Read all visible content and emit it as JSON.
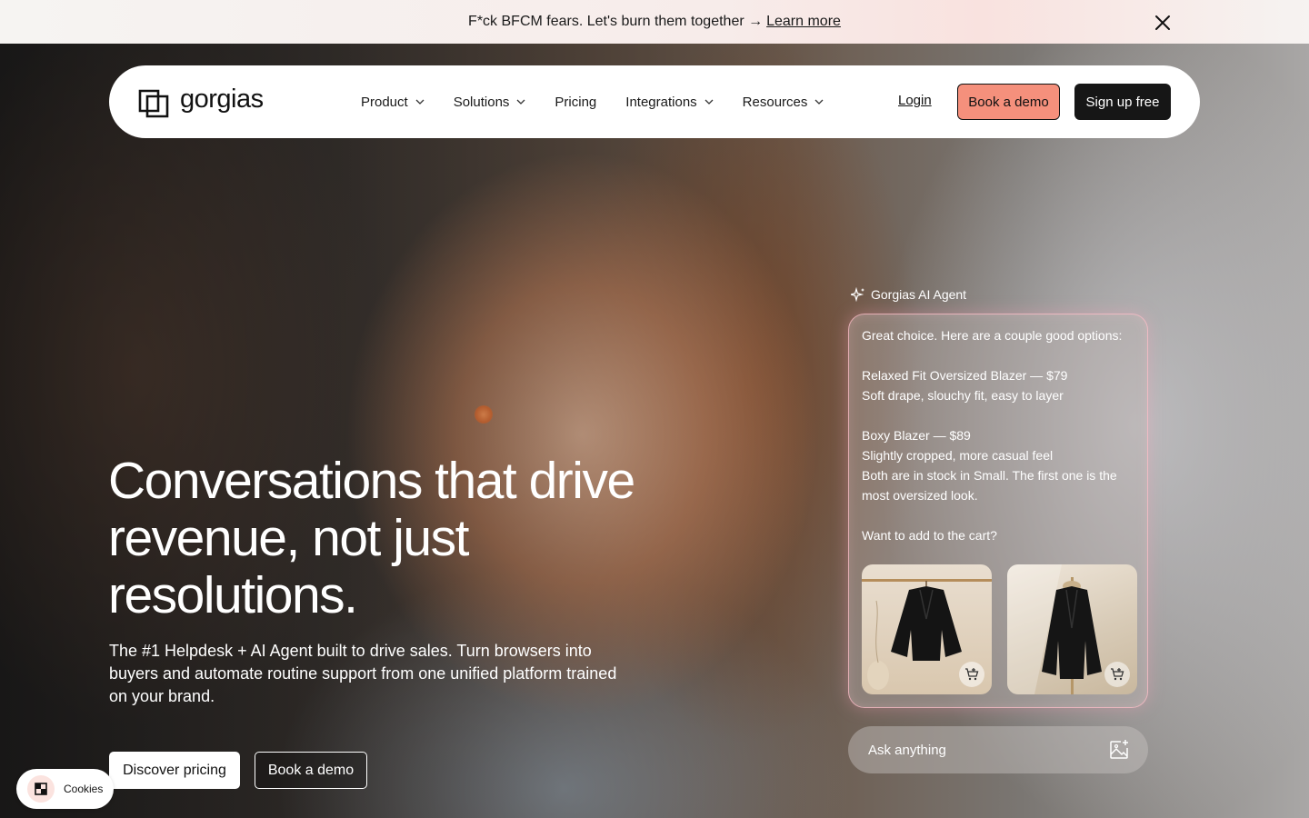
{
  "announcement": {
    "text": "F*ck BFCM fears. Let's burn them together →",
    "link": "Learn more"
  },
  "nav": {
    "logo": "gorgias",
    "menu": [
      {
        "label": "Product",
        "dropdown": true
      },
      {
        "label": "Solutions",
        "dropdown": true
      },
      {
        "label": "Pricing",
        "dropdown": false
      },
      {
        "label": "Integrations",
        "dropdown": true
      },
      {
        "label": "Resources",
        "dropdown": true
      }
    ],
    "login": "Login",
    "book_demo": "Book a demo",
    "sign_up": "Sign up free"
  },
  "hero": {
    "headline": "Conversations that drive revenue, not just resolutions.",
    "subheadline": "The #1 Helpdesk + AI Agent built to drive sales. Turn browsers into buyers and automate routine support from one unified platform trained on your brand.",
    "discover_pricing": "Discover pricing",
    "book_demo": "Book a demo"
  },
  "agent": {
    "label": "Gorgias AI Agent",
    "intro": "Great choice. Here are a couple good options:",
    "option1_title": "Relaxed Fit Oversized Blazer — $79",
    "option1_desc": "Soft drape, slouchy fit, easy to layer",
    "option2_title": "Boxy Blazer — $89",
    "option2_desc": "Slightly cropped, more casual feel",
    "stock_note": "Both are in stock in Small. The first one is the most oversized look.",
    "question": "Want to add to the cart?",
    "ask_placeholder": "Ask anything"
  },
  "cookies": {
    "label": "Cookies"
  },
  "colors": {
    "demo_button": "#f5907c",
    "signup_button": "#161616",
    "chat_border": "#ffbec8"
  }
}
